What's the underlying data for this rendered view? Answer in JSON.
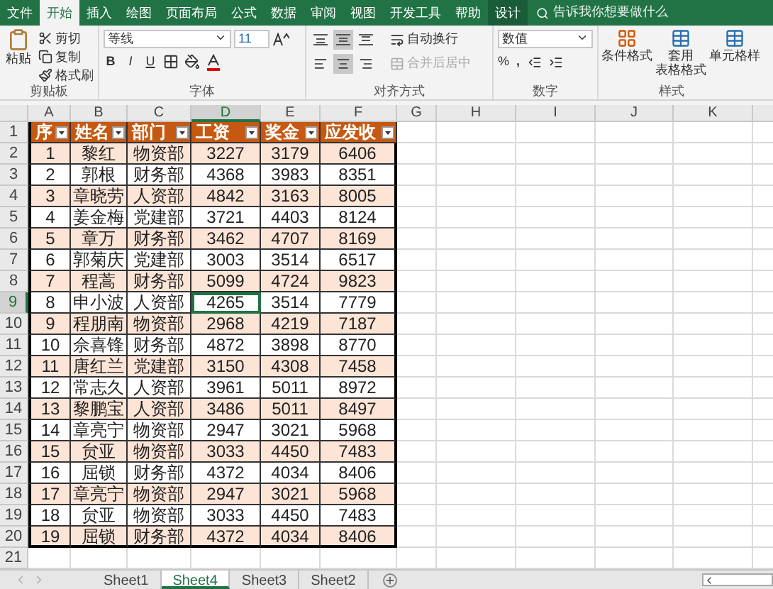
{
  "tabs": [
    {
      "label": "文件",
      "selected": false,
      "contextual": false
    },
    {
      "label": "开始",
      "selected": true,
      "contextual": false
    },
    {
      "label": "插入",
      "selected": false,
      "contextual": false
    },
    {
      "label": "绘图",
      "selected": false,
      "contextual": false
    },
    {
      "label": "页面布局",
      "selected": false,
      "contextual": false
    },
    {
      "label": "公式",
      "selected": false,
      "contextual": false
    },
    {
      "label": "数据",
      "selected": false,
      "contextual": false
    },
    {
      "label": "审阅",
      "selected": false,
      "contextual": false
    },
    {
      "label": "视图",
      "selected": false,
      "contextual": false
    },
    {
      "label": "开发工具",
      "selected": false,
      "contextual": false
    },
    {
      "label": "帮助",
      "selected": false,
      "contextual": false
    },
    {
      "label": "设计",
      "selected": false,
      "contextual": true
    }
  ],
  "tell_me": {
    "placeholder": "告诉我你想要做什么"
  },
  "ribbon": {
    "clipboard": {
      "paste": "粘贴",
      "cut": "剪切",
      "copy": "复制",
      "format_painter": "格式刷",
      "label": "剪贴板"
    },
    "font": {
      "name": "等线",
      "size": "11",
      "bold": "B",
      "italic": "I",
      "underline": "U",
      "label": "字体"
    },
    "alignment": {
      "vertical": [
        {
          "selected": false
        },
        {
          "selected": true
        },
        {
          "selected": false
        }
      ],
      "horizontal": [
        {
          "selected": false
        },
        {
          "selected": true
        },
        {
          "selected": false
        }
      ],
      "wrap": "自动换行",
      "merge": "合并后居中",
      "merge_disabled": true,
      "label": "对齐方式"
    },
    "number": {
      "format": "数值",
      "percent": "%",
      "comma": ",",
      "label": "数字"
    },
    "styles": {
      "conditional": "条件格式",
      "table_format_top": "套用",
      "table_format_bottom": "表格格式",
      "cell_styles": "单元格样",
      "label": "样式"
    }
  },
  "grid": {
    "columns": [
      {
        "label": "A",
        "selected": false
      },
      {
        "label": "B",
        "selected": false
      },
      {
        "label": "C",
        "selected": false
      },
      {
        "label": "D",
        "selected": true
      },
      {
        "label": "E",
        "selected": false
      },
      {
        "label": "F",
        "selected": false
      },
      {
        "label": "G",
        "selected": false
      },
      {
        "label": "H",
        "selected": false
      },
      {
        "label": "I",
        "selected": false
      },
      {
        "label": "J",
        "selected": false
      },
      {
        "label": "K",
        "selected": false
      }
    ],
    "header_row": {
      "label": "1",
      "selected": false,
      "cells": [
        "序",
        "姓名",
        "部门",
        "工资",
        "奖金",
        "应发收"
      ]
    },
    "rows": [
      {
        "label": "2",
        "selected": false,
        "cells": [
          {
            "text": "1",
            "selected": false
          },
          {
            "text": "黎红",
            "selected": false
          },
          {
            "text": "物资部",
            "selected": false
          },
          {
            "text": "3227",
            "selected": false
          },
          {
            "text": "3179",
            "selected": false
          },
          {
            "text": "6406",
            "selected": false
          }
        ]
      },
      {
        "label": "3",
        "selected": false,
        "cells": [
          {
            "text": "2",
            "selected": false
          },
          {
            "text": "郭根",
            "selected": false
          },
          {
            "text": "财务部",
            "selected": false
          },
          {
            "text": "4368",
            "selected": false
          },
          {
            "text": "3983",
            "selected": false
          },
          {
            "text": "8351",
            "selected": false
          }
        ]
      },
      {
        "label": "4",
        "selected": false,
        "cells": [
          {
            "text": "3",
            "selected": false
          },
          {
            "text": "章晓劳",
            "selected": false
          },
          {
            "text": "人资部",
            "selected": false
          },
          {
            "text": "4842",
            "selected": false
          },
          {
            "text": "3163",
            "selected": false
          },
          {
            "text": "8005",
            "selected": false
          }
        ]
      },
      {
        "label": "5",
        "selected": false,
        "cells": [
          {
            "text": "4",
            "selected": false
          },
          {
            "text": "姜金梅",
            "selected": false
          },
          {
            "text": "党建部",
            "selected": false
          },
          {
            "text": "3721",
            "selected": false
          },
          {
            "text": "4403",
            "selected": false
          },
          {
            "text": "8124",
            "selected": false
          }
        ]
      },
      {
        "label": "6",
        "selected": false,
        "cells": [
          {
            "text": "5",
            "selected": false
          },
          {
            "text": "章万",
            "selected": false
          },
          {
            "text": "财务部",
            "selected": false
          },
          {
            "text": "3462",
            "selected": false
          },
          {
            "text": "4707",
            "selected": false
          },
          {
            "text": "8169",
            "selected": false
          }
        ]
      },
      {
        "label": "7",
        "selected": false,
        "cells": [
          {
            "text": "6",
            "selected": false
          },
          {
            "text": "郭菊庆",
            "selected": false
          },
          {
            "text": "党建部",
            "selected": false
          },
          {
            "text": "3003",
            "selected": false
          },
          {
            "text": "3514",
            "selected": false
          },
          {
            "text": "6517",
            "selected": false
          }
        ]
      },
      {
        "label": "8",
        "selected": false,
        "cells": [
          {
            "text": "7",
            "selected": false
          },
          {
            "text": "程蒿",
            "selected": false
          },
          {
            "text": "财务部",
            "selected": false
          },
          {
            "text": "5099",
            "selected": false
          },
          {
            "text": "4724",
            "selected": false
          },
          {
            "text": "9823",
            "selected": false
          }
        ]
      },
      {
        "label": "9",
        "selected": true,
        "cells": [
          {
            "text": "8",
            "selected": false
          },
          {
            "text": "申小波",
            "selected": false
          },
          {
            "text": "人资部",
            "selected": false
          },
          {
            "text": "4265",
            "selected": true
          },
          {
            "text": "3514",
            "selected": false
          },
          {
            "text": "7779",
            "selected": false
          }
        ]
      },
      {
        "label": "10",
        "selected": false,
        "cells": [
          {
            "text": "9",
            "selected": false
          },
          {
            "text": "程朋南",
            "selected": false
          },
          {
            "text": "物资部",
            "selected": false
          },
          {
            "text": "2968",
            "selected": false
          },
          {
            "text": "4219",
            "selected": false
          },
          {
            "text": "7187",
            "selected": false
          }
        ]
      },
      {
        "label": "11",
        "selected": false,
        "cells": [
          {
            "text": "10",
            "selected": false
          },
          {
            "text": "佘喜锋",
            "selected": false
          },
          {
            "text": "财务部",
            "selected": false
          },
          {
            "text": "4872",
            "selected": false
          },
          {
            "text": "3898",
            "selected": false
          },
          {
            "text": "8770",
            "selected": false
          }
        ]
      },
      {
        "label": "12",
        "selected": false,
        "cells": [
          {
            "text": "11",
            "selected": false
          },
          {
            "text": "唐红兰",
            "selected": false
          },
          {
            "text": "党建部",
            "selected": false
          },
          {
            "text": "3150",
            "selected": false
          },
          {
            "text": "4308",
            "selected": false
          },
          {
            "text": "7458",
            "selected": false
          }
        ]
      },
      {
        "label": "13",
        "selected": false,
        "cells": [
          {
            "text": "12",
            "selected": false
          },
          {
            "text": "常志久",
            "selected": false
          },
          {
            "text": "人资部",
            "selected": false
          },
          {
            "text": "3961",
            "selected": false
          },
          {
            "text": "5011",
            "selected": false
          },
          {
            "text": "8972",
            "selected": false
          }
        ]
      },
      {
        "label": "14",
        "selected": false,
        "cells": [
          {
            "text": "13",
            "selected": false
          },
          {
            "text": "黎鹏宝",
            "selected": false
          },
          {
            "text": "人资部",
            "selected": false
          },
          {
            "text": "3486",
            "selected": false
          },
          {
            "text": "5011",
            "selected": false
          },
          {
            "text": "8497",
            "selected": false
          }
        ]
      },
      {
        "label": "15",
        "selected": false,
        "cells": [
          {
            "text": "14",
            "selected": false
          },
          {
            "text": "章亮宁",
            "selected": false
          },
          {
            "text": "物资部",
            "selected": false
          },
          {
            "text": "2947",
            "selected": false
          },
          {
            "text": "3021",
            "selected": false
          },
          {
            "text": "5968",
            "selected": false
          }
        ]
      },
      {
        "label": "16",
        "selected": false,
        "cells": [
          {
            "text": "15",
            "selected": false
          },
          {
            "text": "贠亚",
            "selected": false
          },
          {
            "text": "物资部",
            "selected": false
          },
          {
            "text": "3033",
            "selected": false
          },
          {
            "text": "4450",
            "selected": false
          },
          {
            "text": "7483",
            "selected": false
          }
        ]
      },
      {
        "label": "17",
        "selected": false,
        "cells": [
          {
            "text": "16",
            "selected": false
          },
          {
            "text": "屈锁",
            "selected": false
          },
          {
            "text": "财务部",
            "selected": false
          },
          {
            "text": "4372",
            "selected": false
          },
          {
            "text": "4034",
            "selected": false
          },
          {
            "text": "8406",
            "selected": false
          }
        ]
      },
      {
        "label": "18",
        "selected": false,
        "cells": [
          {
            "text": "17",
            "selected": false
          },
          {
            "text": "章亮宁",
            "selected": false
          },
          {
            "text": "物资部",
            "selected": false
          },
          {
            "text": "2947",
            "selected": false
          },
          {
            "text": "3021",
            "selected": false
          },
          {
            "text": "5968",
            "selected": false
          }
        ]
      },
      {
        "label": "19",
        "selected": false,
        "cells": [
          {
            "text": "18",
            "selected": false
          },
          {
            "text": "贠亚",
            "selected": false
          },
          {
            "text": "物资部",
            "selected": false
          },
          {
            "text": "3033",
            "selected": false
          },
          {
            "text": "4450",
            "selected": false
          },
          {
            "text": "7483",
            "selected": false
          }
        ]
      },
      {
        "label": "20",
        "selected": false,
        "cells": [
          {
            "text": "19",
            "selected": false
          },
          {
            "text": "屈锁",
            "selected": false
          },
          {
            "text": "财务部",
            "selected": false
          },
          {
            "text": "4372",
            "selected": false
          },
          {
            "text": "4034",
            "selected": false
          },
          {
            "text": "8406",
            "selected": false
          }
        ]
      }
    ],
    "empty_rows": [
      {
        "label": "21",
        "selected": false
      }
    ]
  },
  "sheets": [
    {
      "label": "Sheet1",
      "selected": false
    },
    {
      "label": "Sheet4",
      "selected": true
    },
    {
      "label": "Sheet3",
      "selected": false
    },
    {
      "label": "Sheet2",
      "selected": false
    }
  ]
}
